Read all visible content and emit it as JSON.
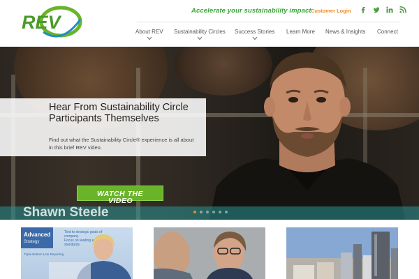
{
  "brand": {
    "logo_text": "REV",
    "accent_green": "#6ab42a",
    "accent_orange": "#f08a1c"
  },
  "header": {
    "tagline": "Accelerate your sustainability impact",
    "login_label": "Customer Login",
    "social": [
      {
        "icon": "facebook-icon",
        "glyph": "f"
      },
      {
        "icon": "twitter-icon",
        "glyph": "t"
      },
      {
        "icon": "linkedin-icon",
        "glyph": "in"
      },
      {
        "icon": "rss-icon",
        "glyph": "rss"
      }
    ]
  },
  "nav": {
    "items": [
      {
        "label": "About REV",
        "has_dropdown": true
      },
      {
        "label": "Sustainability Circles",
        "has_dropdown": true
      },
      {
        "label": "Success Stories",
        "has_dropdown": true
      },
      {
        "label": "Learn More",
        "has_dropdown": false
      },
      {
        "label": "News & Insights",
        "has_dropdown": false
      },
      {
        "label": "Connect",
        "has_dropdown": false
      }
    ]
  },
  "hero": {
    "title": "Hear From Sustainability Circle Participants Themselves",
    "description": "Find out what the Sustainability Circle® experience is all about in this brief REV video.",
    "cta_label": "WATCH THE",
    "cta_label_line2": "VIDEO",
    "person_name": "Shawn Steele",
    "slides": {
      "count": 6,
      "active_index": 0
    }
  },
  "thumbnails": [
    {
      "title_a": "Advanced",
      "title_b": "Strategy",
      "lines": [
        "Tied to strategic goals of",
        "company",
        "Focus on leading edge",
        "standards"
      ],
      "footer": "Triple Bottom Line Reporting"
    },
    {},
    {}
  ]
}
